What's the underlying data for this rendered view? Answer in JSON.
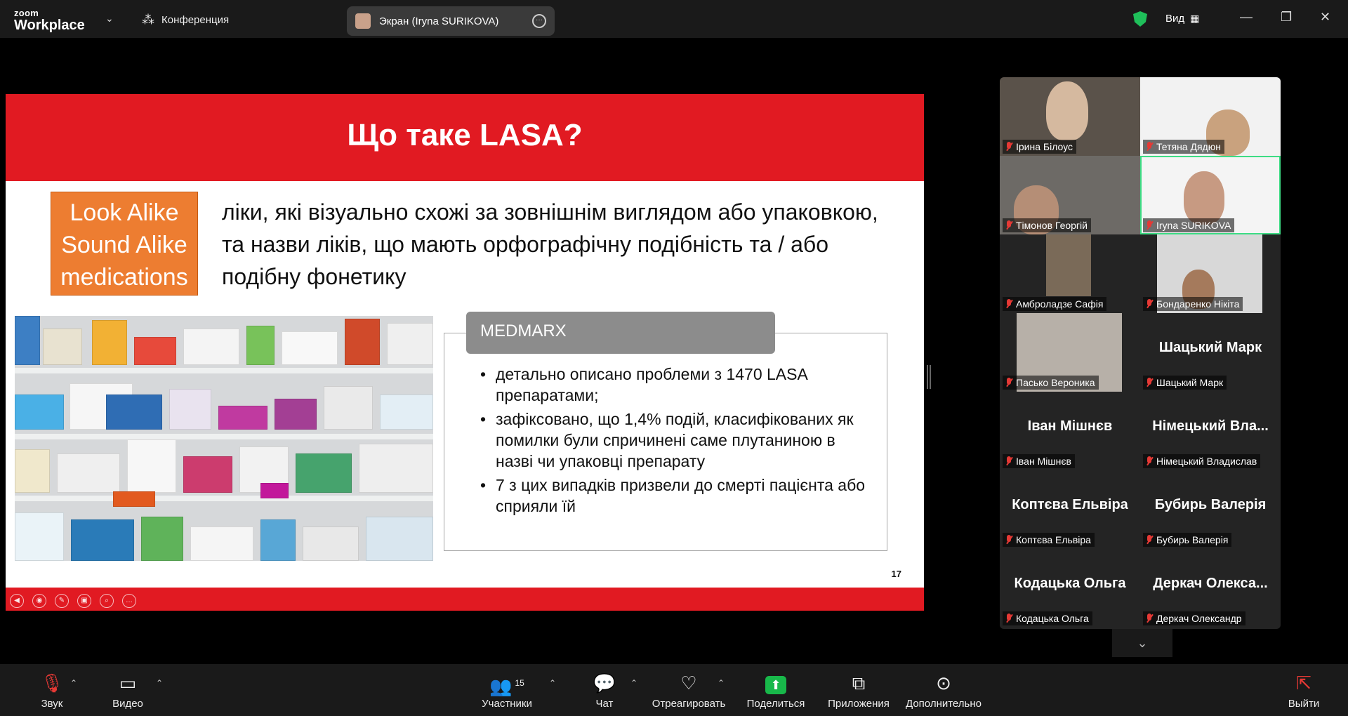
{
  "app": {
    "brand_top": "zoom",
    "brand_bottom": "Workplace",
    "menu_label": "Конференция",
    "view_label": "Вид"
  },
  "screen_share": {
    "label": "Экран (Iryna SURIKOVA)"
  },
  "slide": {
    "title": "Що таке LASA?",
    "box_lines": [
      "Look Alike",
      "Sound Alike",
      "medications"
    ],
    "definition": "ліки, які візуально схожі за зовнішнім виглядом або упаковкою, та назви ліків, що мають орфографічну подібність та / або подібну фонетику",
    "card_title": "MEDMARX",
    "bullets": [
      "детально описано проблеми з 1470 LASA препаратами;",
      "зафіксовано, що 1,4% подій, класифікованих як помилки були спричинені саме плутаниною в назві чи упаковці препарату",
      "7 з цих випадків призвели до смерті пацієнта або сприяли їй"
    ],
    "page_number": "17"
  },
  "gallery": [
    {
      "label": "Ірина Білоус",
      "video": true
    },
    {
      "label": "Тетяна Дядюн",
      "video": true
    },
    {
      "label": "Тімонов Георгій",
      "video": true
    },
    {
      "label": "Iryna SURIKOVA",
      "video": true,
      "active": true
    },
    {
      "label": "Амброладзе Сафія",
      "video": true
    },
    {
      "label": "Бондаренко Нікіта",
      "video": true
    },
    {
      "label": "Пасько Вероника",
      "video": true
    },
    {
      "label": "Шацький Марк",
      "big": "Шацький Марк"
    },
    {
      "label": "Іван Мішнєв",
      "big": "Іван Мішнєв"
    },
    {
      "label": "Німецький Владислав",
      "big": "Німецький Вла..."
    },
    {
      "label": "Коптєва Ельвіра",
      "big": "Коптєва Ельвіра"
    },
    {
      "label": "Бубирь Валерія",
      "big": "Бубирь Валерія"
    },
    {
      "label": "Кодацька Ольга",
      "big": "Кодацька Ольга"
    },
    {
      "label": "Деркач Олександр",
      "big": "Деркач Олекса..."
    }
  ],
  "toolbar": {
    "audio": "Звук",
    "video": "Видео",
    "participants": "Участники",
    "participants_count": "15",
    "chat": "Чат",
    "react": "Отреагировать",
    "share": "Поделиться",
    "apps": "Приложения",
    "more": "Дополнительно",
    "leave": "Выйти"
  },
  "colors": {
    "slide_red": "#e11a22",
    "lasa_orange": "#ed7d31",
    "share_green": "#18b84a",
    "active_border": "#3ddc84"
  }
}
